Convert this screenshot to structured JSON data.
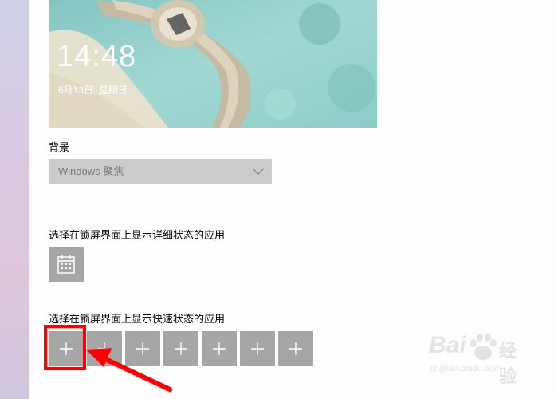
{
  "lockscreen_preview": {
    "time": "14:48",
    "date": "6月13日, 星期日"
  },
  "background": {
    "label": "背景",
    "selected": "Windows 聚焦",
    "icon": "chevron-down-icon"
  },
  "detailed_status": {
    "label": "选择在锁屏界面上显示详细状态的应用",
    "app_icon": "calendar-icon"
  },
  "quick_status": {
    "label": "选择在锁屏界面上显示快速状态的应用",
    "slots": [
      "+",
      "+",
      "+",
      "+",
      "+",
      "+",
      "+"
    ],
    "slot_icon": "plus-icon"
  },
  "annotation": {
    "color": "#ff0000",
    "target": "quick-status-slot-1"
  },
  "watermark": {
    "brand": "Bai",
    "brand_suffix": "du",
    "cn": "经验",
    "url": "jingyan.baidu.com"
  }
}
